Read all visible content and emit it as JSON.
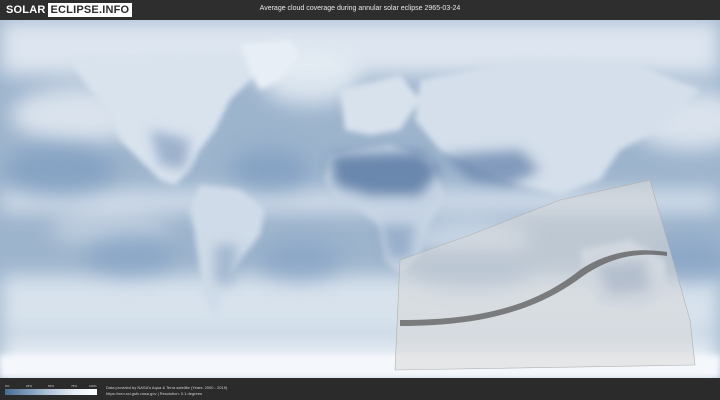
{
  "logo": {
    "part1": "SOLAR",
    "part2": "ECLIPSE.INFO"
  },
  "header": {
    "title": "Average cloud coverage during annular solar eclipse 2965-03-24"
  },
  "map": {
    "projection": "equirectangular",
    "colors": {
      "ocean_clear": "#8aa6c6",
      "cloud": "#eef3f8",
      "land_clear": "#5f7ea8",
      "eclipse_zone": "#d8d8d8",
      "central_line": "#5a5a5a"
    }
  },
  "legend": {
    "ticks": [
      "0%",
      "25%",
      "50%",
      "75%",
      "100%"
    ]
  },
  "credits": {
    "line1": "Data provided by NASA's Aqua & Terra satellite (Years: 2000 - 2019)",
    "line2": "https://neo.sci.gsfc.nasa.gov | Resolution: 0.1 degrees"
  }
}
